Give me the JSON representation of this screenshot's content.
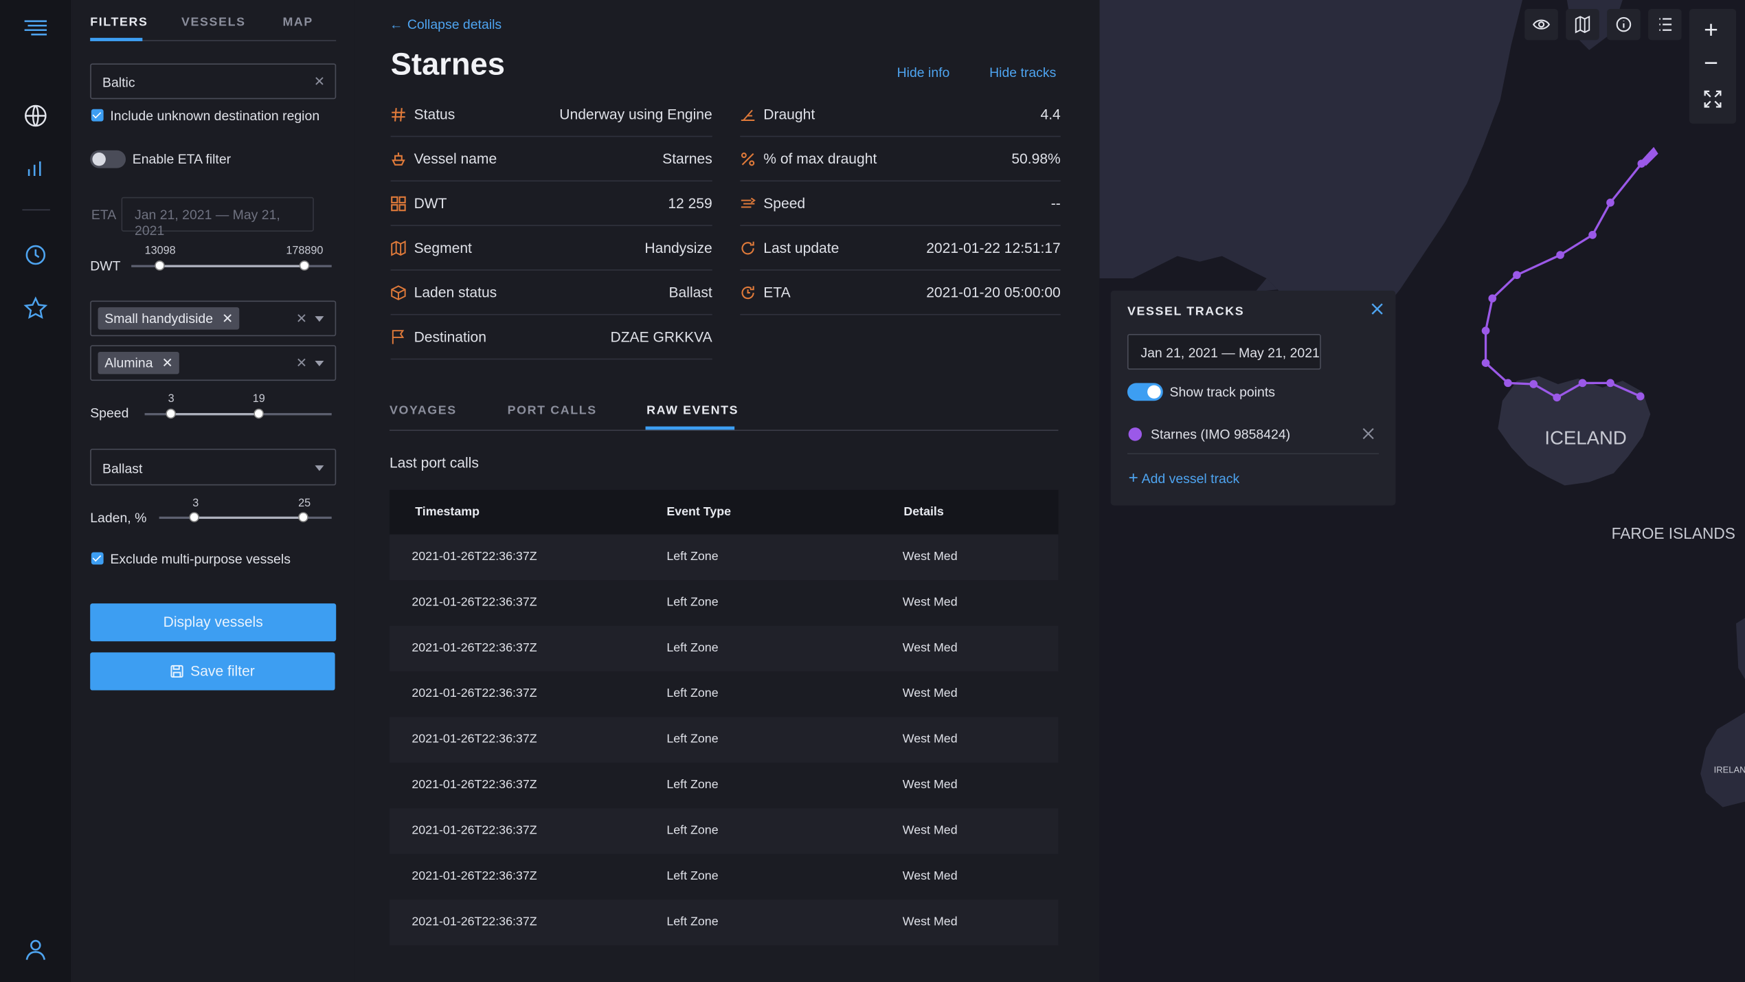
{
  "rail": {
    "icons": [
      "menu-icon",
      "globe-icon",
      "chart-icon",
      "clock-icon",
      "star-icon",
      "user-icon"
    ]
  },
  "filters": {
    "tabs": [
      "FILTERS",
      "VESSELS",
      "MAP"
    ],
    "region_value": "Baltic",
    "include_unknown_label": "Include unknown destination region",
    "eta_toggle_label": "Enable ETA filter",
    "eta_label": "ETA",
    "eta_range": "Jan 21, 2021 — May 21, 2021",
    "dwt_label": "DWT",
    "dwt_min": "13098",
    "dwt_max": "178890",
    "segment_chip": "Small handydiside",
    "cargo_chip": "Alumina",
    "speed_label": "Speed",
    "speed_min": "3",
    "speed_max": "19",
    "laden_select": "Ballast",
    "laden_label": "Laden, %",
    "laden_min": "3",
    "laden_max": "25",
    "exclude_label": "Exclude multi-purpose vessels",
    "display_button": "Display vessels",
    "save_button": "Save filter"
  },
  "details": {
    "collapse_label": "Collapse details",
    "title": "Starnes",
    "hide_info": "Hide info",
    "hide_tracks": "Hide tracks",
    "left_props": [
      {
        "icon": "hash-icon",
        "key": "Status",
        "value": "Underway using Engine"
      },
      {
        "icon": "ship-icon",
        "key": "Vessel name",
        "value": "Starnes"
      },
      {
        "icon": "grid-icon",
        "key": "DWT",
        "value": "12 259"
      },
      {
        "icon": "map-icon",
        "key": "Segment",
        "value": "Handysize"
      },
      {
        "icon": "box-icon",
        "key": "Laden status",
        "value": "Ballast"
      },
      {
        "icon": "flag-icon",
        "key": "Destination",
        "value": "DZAE GRKKVA"
      }
    ],
    "right_props": [
      {
        "icon": "draught-icon",
        "key": "Draught",
        "value": "4.4"
      },
      {
        "icon": "percent-icon",
        "key": "% of max draught",
        "value": "50.98%"
      },
      {
        "icon": "speed-icon",
        "key": "Speed",
        "value": "--"
      },
      {
        "icon": "refresh-icon",
        "key": "Last update",
        "value": "2021-01-22 12:51:17"
      },
      {
        "icon": "eta-icon",
        "key": "ETA",
        "value": "2021-01-20 05:00:00"
      }
    ],
    "tabs": [
      "VOYAGES",
      "PORT CALLS",
      "RAW EVENTS"
    ],
    "section_title": "Last port calls",
    "columns": [
      "Timestamp",
      "Event Type",
      "Details"
    ],
    "rows": [
      [
        "2021-01-26T22:36:37Z",
        "Left Zone",
        "West Med"
      ],
      [
        "2021-01-26T22:36:37Z",
        "Left Zone",
        "West Med"
      ],
      [
        "2021-01-26T22:36:37Z",
        "Left Zone",
        "West Med"
      ],
      [
        "2021-01-26T22:36:37Z",
        "Left Zone",
        "West Med"
      ],
      [
        "2021-01-26T22:36:37Z",
        "Left Zone",
        "West Med"
      ],
      [
        "2021-01-26T22:36:37Z",
        "Left Zone",
        "West Med"
      ],
      [
        "2021-01-26T22:36:37Z",
        "Left Zone",
        "West Med"
      ],
      [
        "2021-01-26T22:36:37Z",
        "Left Zone",
        "West Med"
      ],
      [
        "2021-01-26T22:36:37Z",
        "Left Zone",
        "West Med"
      ]
    ]
  },
  "map": {
    "toolbar_icons": [
      "eye-icon",
      "map-layers-icon",
      "info-icon",
      "list-icon"
    ],
    "zoom_in": "+",
    "zoom_out": "−",
    "labels": {
      "iceland": "ICELAND",
      "faroe": "FAROE ISLANDS",
      "ireland": "IRELAN"
    },
    "track_color": "#9b59e8",
    "vessel_tracks": {
      "title": "VESSEL TRACKS",
      "date_range": "Jan 21, 2021 — May 21, 2021",
      "show_points_label": "Show track points",
      "vessel": "Starnes (IMO 9858424)",
      "add_label": "Add vessel track"
    }
  },
  "colors": {
    "accent": "#3d9ef2",
    "icon_accent": "#e07a3a",
    "track": "#9b59e8"
  }
}
